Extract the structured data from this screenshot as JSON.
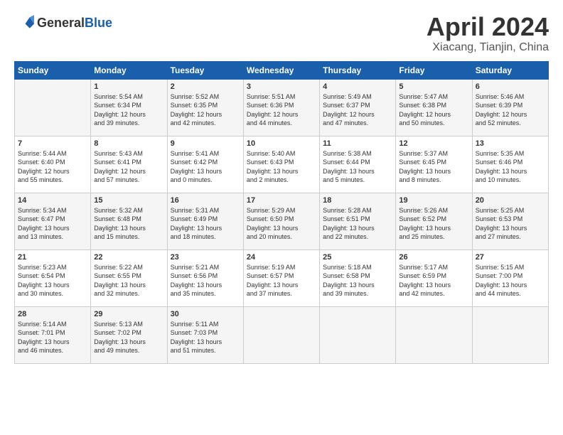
{
  "header": {
    "logo_general": "General",
    "logo_blue": "Blue",
    "title": "April 2024",
    "subtitle": "Xiacang, Tianjin, China"
  },
  "days_of_week": [
    "Sunday",
    "Monday",
    "Tuesday",
    "Wednesday",
    "Thursday",
    "Friday",
    "Saturday"
  ],
  "weeks": [
    [
      {
        "day": "",
        "info": ""
      },
      {
        "day": "1",
        "info": "Sunrise: 5:54 AM\nSunset: 6:34 PM\nDaylight: 12 hours\nand 39 minutes."
      },
      {
        "day": "2",
        "info": "Sunrise: 5:52 AM\nSunset: 6:35 PM\nDaylight: 12 hours\nand 42 minutes."
      },
      {
        "day": "3",
        "info": "Sunrise: 5:51 AM\nSunset: 6:36 PM\nDaylight: 12 hours\nand 44 minutes."
      },
      {
        "day": "4",
        "info": "Sunrise: 5:49 AM\nSunset: 6:37 PM\nDaylight: 12 hours\nand 47 minutes."
      },
      {
        "day": "5",
        "info": "Sunrise: 5:47 AM\nSunset: 6:38 PM\nDaylight: 12 hours\nand 50 minutes."
      },
      {
        "day": "6",
        "info": "Sunrise: 5:46 AM\nSunset: 6:39 PM\nDaylight: 12 hours\nand 52 minutes."
      }
    ],
    [
      {
        "day": "7",
        "info": "Sunrise: 5:44 AM\nSunset: 6:40 PM\nDaylight: 12 hours\nand 55 minutes."
      },
      {
        "day": "8",
        "info": "Sunrise: 5:43 AM\nSunset: 6:41 PM\nDaylight: 12 hours\nand 57 minutes."
      },
      {
        "day": "9",
        "info": "Sunrise: 5:41 AM\nSunset: 6:42 PM\nDaylight: 13 hours\nand 0 minutes."
      },
      {
        "day": "10",
        "info": "Sunrise: 5:40 AM\nSunset: 6:43 PM\nDaylight: 13 hours\nand 2 minutes."
      },
      {
        "day": "11",
        "info": "Sunrise: 5:38 AM\nSunset: 6:44 PM\nDaylight: 13 hours\nand 5 minutes."
      },
      {
        "day": "12",
        "info": "Sunrise: 5:37 AM\nSunset: 6:45 PM\nDaylight: 13 hours\nand 8 minutes."
      },
      {
        "day": "13",
        "info": "Sunrise: 5:35 AM\nSunset: 6:46 PM\nDaylight: 13 hours\nand 10 minutes."
      }
    ],
    [
      {
        "day": "14",
        "info": "Sunrise: 5:34 AM\nSunset: 6:47 PM\nDaylight: 13 hours\nand 13 minutes."
      },
      {
        "day": "15",
        "info": "Sunrise: 5:32 AM\nSunset: 6:48 PM\nDaylight: 13 hours\nand 15 minutes."
      },
      {
        "day": "16",
        "info": "Sunrise: 5:31 AM\nSunset: 6:49 PM\nDaylight: 13 hours\nand 18 minutes."
      },
      {
        "day": "17",
        "info": "Sunrise: 5:29 AM\nSunset: 6:50 PM\nDaylight: 13 hours\nand 20 minutes."
      },
      {
        "day": "18",
        "info": "Sunrise: 5:28 AM\nSunset: 6:51 PM\nDaylight: 13 hours\nand 22 minutes."
      },
      {
        "day": "19",
        "info": "Sunrise: 5:26 AM\nSunset: 6:52 PM\nDaylight: 13 hours\nand 25 minutes."
      },
      {
        "day": "20",
        "info": "Sunrise: 5:25 AM\nSunset: 6:53 PM\nDaylight: 13 hours\nand 27 minutes."
      }
    ],
    [
      {
        "day": "21",
        "info": "Sunrise: 5:23 AM\nSunset: 6:54 PM\nDaylight: 13 hours\nand 30 minutes."
      },
      {
        "day": "22",
        "info": "Sunrise: 5:22 AM\nSunset: 6:55 PM\nDaylight: 13 hours\nand 32 minutes."
      },
      {
        "day": "23",
        "info": "Sunrise: 5:21 AM\nSunset: 6:56 PM\nDaylight: 13 hours\nand 35 minutes."
      },
      {
        "day": "24",
        "info": "Sunrise: 5:19 AM\nSunset: 6:57 PM\nDaylight: 13 hours\nand 37 minutes."
      },
      {
        "day": "25",
        "info": "Sunrise: 5:18 AM\nSunset: 6:58 PM\nDaylight: 13 hours\nand 39 minutes."
      },
      {
        "day": "26",
        "info": "Sunrise: 5:17 AM\nSunset: 6:59 PM\nDaylight: 13 hours\nand 42 minutes."
      },
      {
        "day": "27",
        "info": "Sunrise: 5:15 AM\nSunset: 7:00 PM\nDaylight: 13 hours\nand 44 minutes."
      }
    ],
    [
      {
        "day": "28",
        "info": "Sunrise: 5:14 AM\nSunset: 7:01 PM\nDaylight: 13 hours\nand 46 minutes."
      },
      {
        "day": "29",
        "info": "Sunrise: 5:13 AM\nSunset: 7:02 PM\nDaylight: 13 hours\nand 49 minutes."
      },
      {
        "day": "30",
        "info": "Sunrise: 5:11 AM\nSunset: 7:03 PM\nDaylight: 13 hours\nand 51 minutes."
      },
      {
        "day": "",
        "info": ""
      },
      {
        "day": "",
        "info": ""
      },
      {
        "day": "",
        "info": ""
      },
      {
        "day": "",
        "info": ""
      }
    ]
  ]
}
